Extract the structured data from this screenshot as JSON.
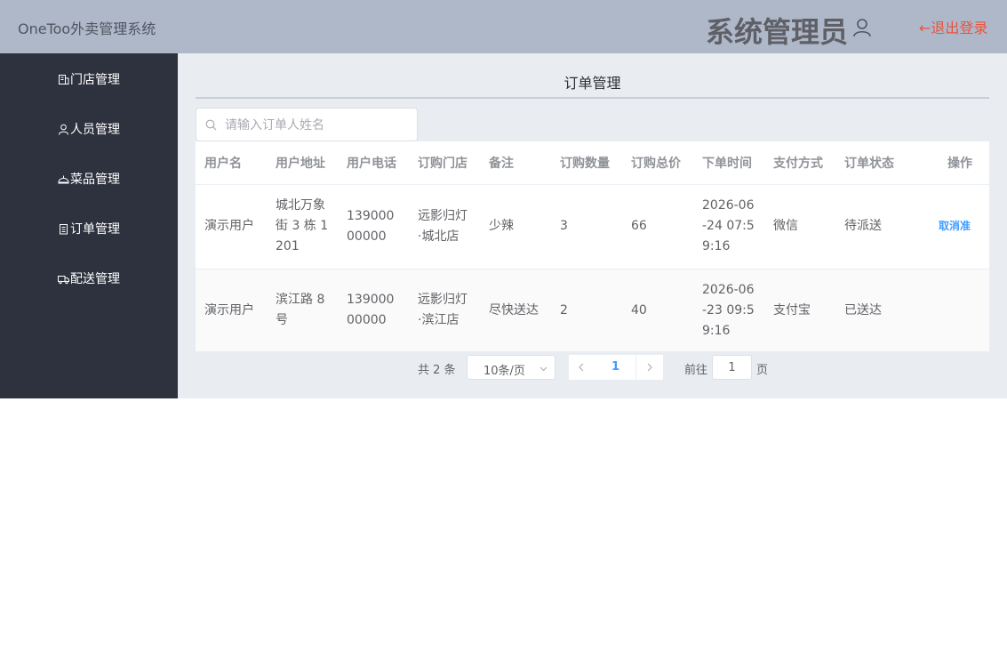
{
  "header": {
    "app_title": "OneToo外卖管理系统",
    "admin_name": "系统管理员",
    "logout": "←退出登录"
  },
  "sidebar": {
    "items": [
      {
        "label": "门店管理",
        "icon": "store-icon"
      },
      {
        "label": "人员管理",
        "icon": "user-icon"
      },
      {
        "label": "菜品管理",
        "icon": "dish-icon"
      },
      {
        "label": "订单管理",
        "icon": "order-icon"
      },
      {
        "label": "配送管理",
        "icon": "truck-icon"
      }
    ]
  },
  "main": {
    "title": "订单管理",
    "search_placeholder": "请输入订单人姓名",
    "columns": [
      "用户名",
      "用户地址",
      "用户电话",
      "订购门店",
      "备注",
      "订购数量",
      "订购总价",
      "下单时间",
      "支付方式",
      "订单状态",
      "操作"
    ],
    "rows": [
      {
        "user": "演示用户",
        "address": "城北万象街 3 栋 1201",
        "phone": "13900000000",
        "store": "远影归灯·城北店",
        "note": "少辣",
        "qty": "3",
        "total": "66",
        "time": "2026-06-24 07:59:16",
        "pay": "微信",
        "status": "待派送",
        "action": "取消准"
      },
      {
        "user": "演示用户",
        "address": "滨江路 8 号",
        "phone": "13900000000",
        "store": "远影归灯·滨江店",
        "note": "尽快送达",
        "qty": "2",
        "total": "40",
        "time": "2026-06-23 09:59:16",
        "pay": "支付宝",
        "status": "已送达",
        "action": ""
      }
    ]
  },
  "pagination": {
    "total": "共 2 条",
    "page_size": "10条/页",
    "current_page": "1",
    "goto_label": "前往",
    "goto_value": "1",
    "goto_suffix": "页"
  },
  "colors": {
    "header_bg": "#aeb8c9",
    "sidebar_bg": "#2e323e",
    "main_bg": "#e9edf2",
    "logout": "#e8543f",
    "link": "#409eff"
  }
}
